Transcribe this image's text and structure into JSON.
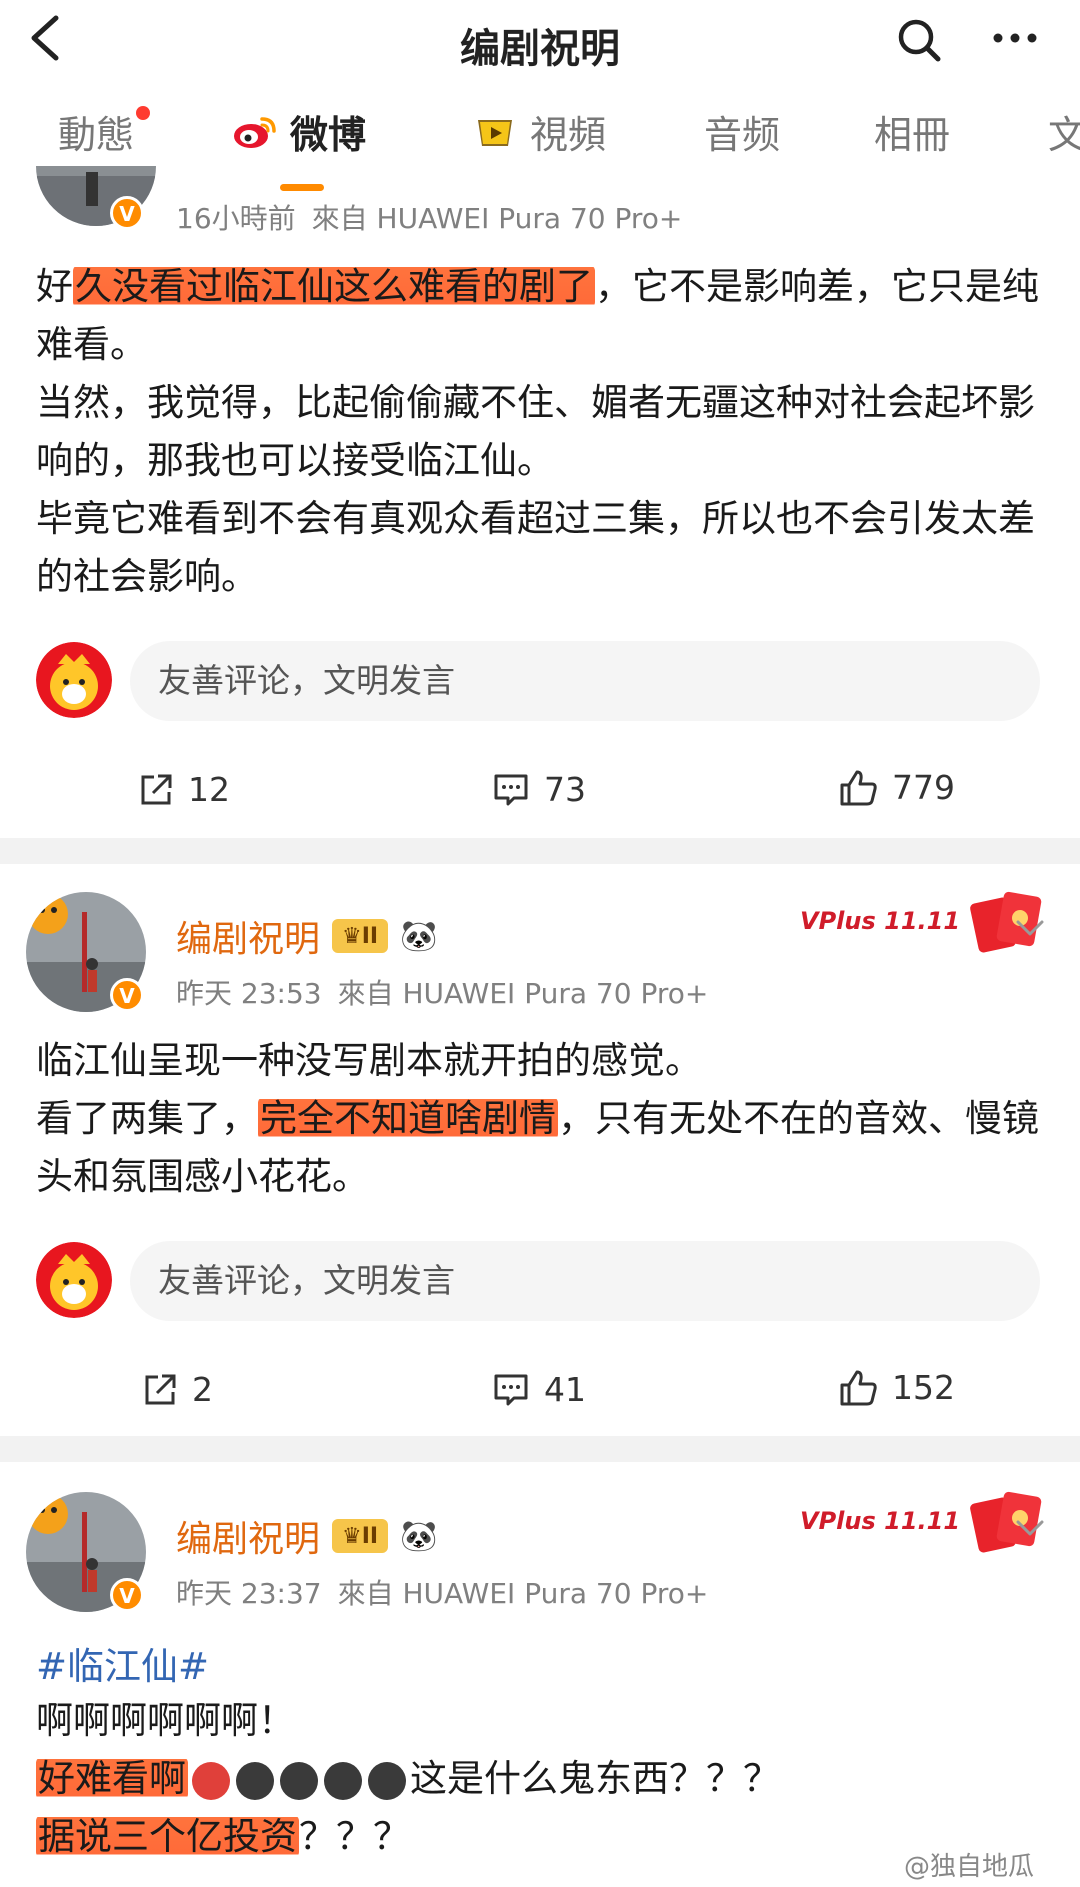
{
  "header": {
    "title": "编剧祝明"
  },
  "tabs": [
    {
      "label": "動態"
    },
    {
      "label": "微博"
    },
    {
      "label": "視頻"
    },
    {
      "label": "音频"
    },
    {
      "label": "相冊"
    },
    {
      "label": "文"
    }
  ],
  "posts": [
    {
      "time": "16小時前",
      "source": "來自 HUAWEI Pura 70 Pro+",
      "text_parts": [
        {
          "text": "好",
          "hl": false
        },
        {
          "text": "久没看过临江仙这么难看的剧了",
          "hl": true
        },
        {
          "text": "，它不是影响差，它只是纯难看。",
          "hl": false
        }
      ],
      "paragraphs": [
        "当然，我觉得，比起偷偷藏不住、媚者无疆这种对社会起坏影响的，那我也可以接受临江仙。",
        "毕竟它难看到不会有真观众看超过三集，所以也不会引发太差的社会影响。"
      ],
      "comment_placeholder": "友善评论，文明发言",
      "reposts": "12",
      "comments": "73",
      "likes": "779"
    },
    {
      "username": "编剧祝明",
      "time": "昨天 23:53",
      "source": "來自 HUAWEI Pura 70 Pro+",
      "badge": "II",
      "vplus": "VPlus 11.11",
      "line1": "临江仙呈现一种没写剧本就开拍的感觉。",
      "line2a": "看了两集了，",
      "line2b": "完全不知道啥剧情",
      "line2c": "，只有无处不在的音效、慢镜头和氛围感小花花。",
      "comment_placeholder": "友善评论，文明发言",
      "reposts": "2",
      "comments": "41",
      "likes": "152"
    },
    {
      "username": "编剧祝明",
      "time": "昨天 23:37",
      "source": "來自 HUAWEI Pura 70 Pro+",
      "badge": "II",
      "vplus": "VPlus 11.11",
      "hashtag": "#临江仙#",
      "line1": "啊啊啊啊啊啊！",
      "line2_hl": "好难看啊",
      "line2_rest": "这是什么鬼东西？？？",
      "line3_hl": "据说三个亿投资",
      "line3_rest": "？？？"
    }
  ],
  "watermark": "@独自地瓜",
  "colors": {
    "accent": "#ff8a00",
    "highlight": "#ff5a23",
    "username": "#e0680f",
    "link": "#3366b3"
  }
}
